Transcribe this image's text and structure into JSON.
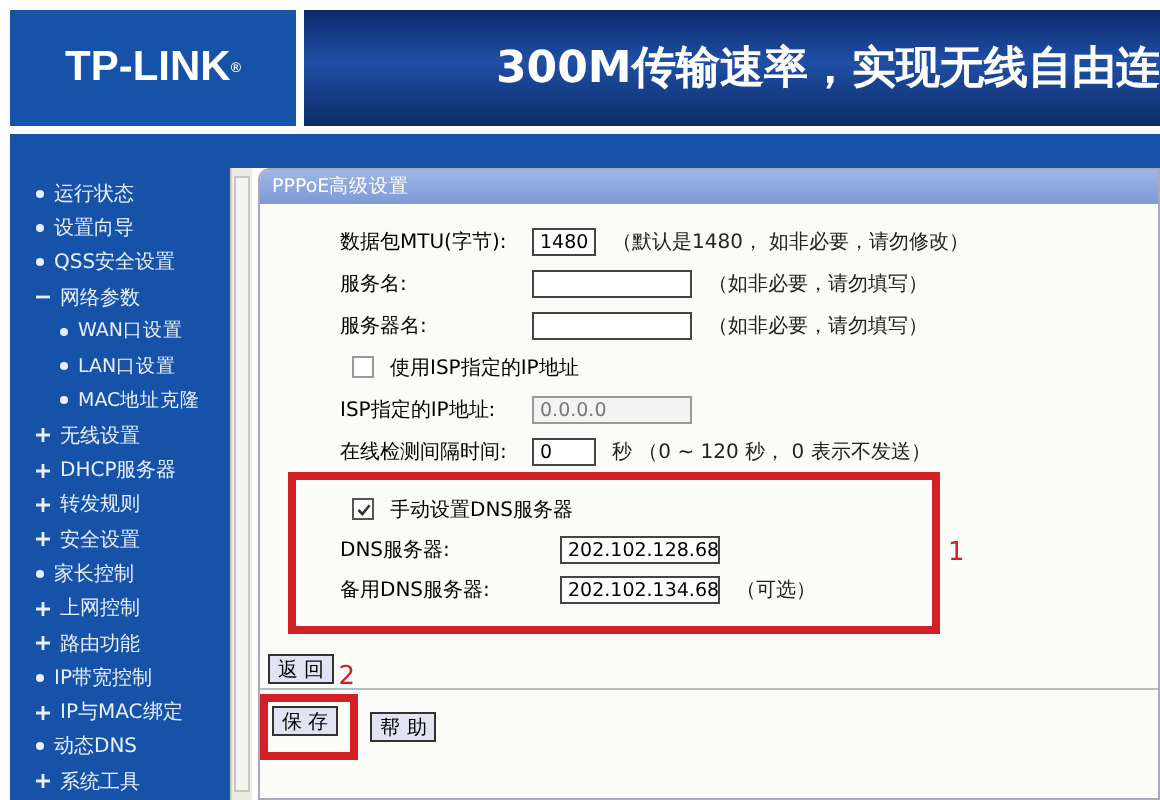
{
  "header": {
    "logo": "TP-LINK$^{®}$",
    "banner_text": "300M传输速率，实现无线自由连"
  },
  "sidebar": {
    "items": [
      {
        "label": "运行状态",
        "kind": "leaf"
      },
      {
        "label": "设置向导",
        "kind": "leaf"
      },
      {
        "label": "QSS安全设置",
        "kind": "leaf"
      },
      {
        "label": "网络参数",
        "kind": "group",
        "expanded": true,
        "children": [
          {
            "label": "WAN口设置",
            "kind": "leaf"
          },
          {
            "label": "LAN口设置",
            "kind": "leaf"
          },
          {
            "label": "MAC地址克隆",
            "kind": "leaf"
          }
        ]
      },
      {
        "label": "无线设置",
        "kind": "group",
        "expanded": false
      },
      {
        "label": "DHCP服务器",
        "kind": "group",
        "expanded": false
      },
      {
        "label": "转发规则",
        "kind": "group",
        "expanded": false
      },
      {
        "label": "安全设置",
        "kind": "group",
        "expanded": false
      },
      {
        "label": "家长控制",
        "kind": "leaf"
      },
      {
        "label": "上网控制",
        "kind": "group",
        "expanded": false
      },
      {
        "label": "路由功能",
        "kind": "group",
        "expanded": false
      },
      {
        "label": "IP带宽控制",
        "kind": "leaf"
      },
      {
        "label": "IP与MAC绑定",
        "kind": "group",
        "expanded": false
      },
      {
        "label": "动态DNS",
        "kind": "leaf"
      },
      {
        "label": "系统工具",
        "kind": "group",
        "expanded": false
      }
    ]
  },
  "form": {
    "title": "PPPoE高级设置",
    "rows": [
      {
        "kind": "short",
        "label": "数据包MTU(字节):",
        "value": "1480",
        "hint": "（默认是1480， 如非必要，请勿修改）",
        "disabled": false
      },
      {
        "kind": "wide",
        "label": "服务名:",
        "value": "",
        "hint": "（如非必要，请勿填写）",
        "disabled": false
      },
      {
        "kind": "wide",
        "label": "服务器名:",
        "value": "",
        "hint": "（如非必要，请勿填写）",
        "disabled": false
      },
      {
        "kind": "checkbox",
        "label": "使用ISP指定的IP地址",
        "checked": false
      },
      {
        "kind": "wide",
        "label": "ISP指定的IP地址:",
        "value": "0.0.0.0",
        "disabled": true
      },
      {
        "kind": "short",
        "label": "在线检测间隔时间:",
        "value": "0",
        "hint": "秒 （0 ~ 120 秒， 0 表示不发送）",
        "disabled": false
      }
    ],
    "highlight": {
      "number": "1",
      "rows": [
        {
          "kind": "checkbox",
          "label": "手动设置DNS服务器",
          "checked": true
        },
        {
          "kind": "wide",
          "label": "DNS服务器:",
          "value": "202.102.128.68",
          "disabled": false
        },
        {
          "kind": "wide",
          "label": "备用DNS服务器:",
          "value": "202.102.134.68",
          "hint": "（可选）",
          "disabled": false
        }
      ]
    },
    "back_button": "返 回",
    "save_number": "2",
    "buttons": [
      "保 存",
      "帮 助"
    ]
  }
}
